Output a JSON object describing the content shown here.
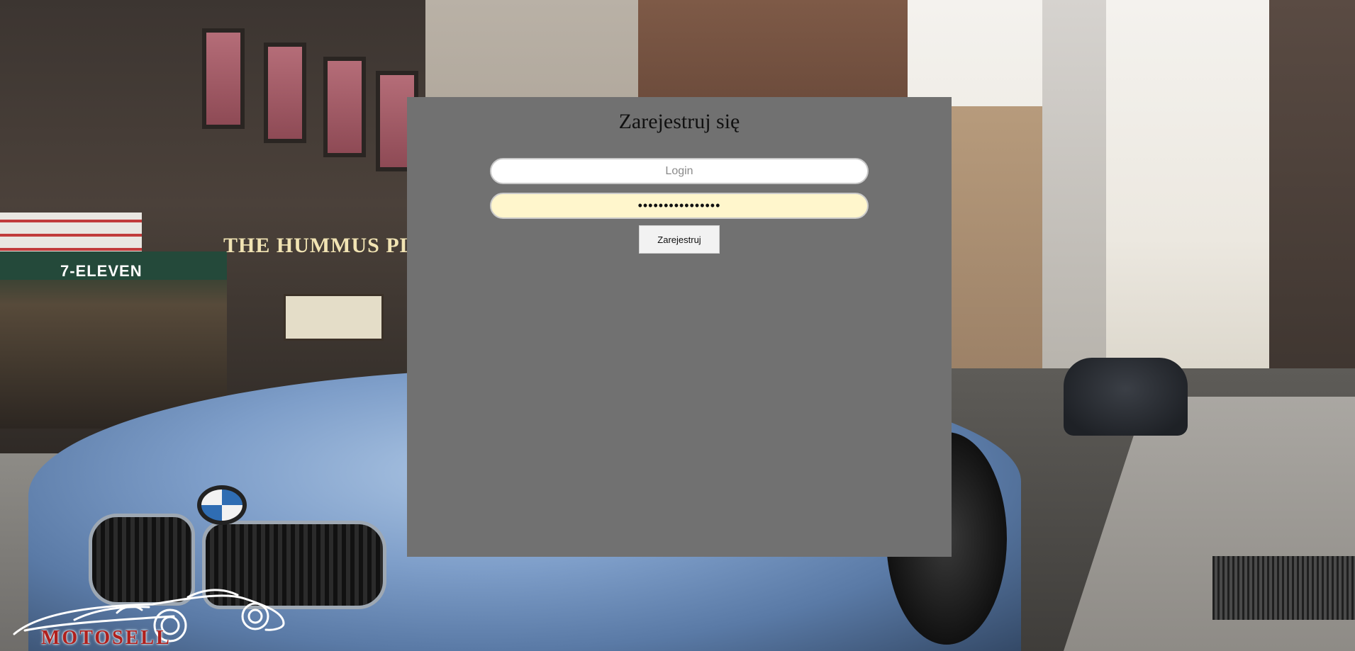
{
  "page": {
    "title": "Zarejestruj się"
  },
  "form": {
    "login_placeholder": "Login",
    "login_value": "",
    "password_value": "................",
    "submit_label": "Zarejestruj"
  },
  "background": {
    "store_awning": "7-ELEVEN",
    "shop_sign": "THE HUMMUS PLACE"
  },
  "logo": {
    "text": "MOTOSELL"
  },
  "colors": {
    "panel": "#717171",
    "password_fill": "#fff6cc",
    "logo_red": "#b0201d",
    "button": "#f2f2f2"
  }
}
